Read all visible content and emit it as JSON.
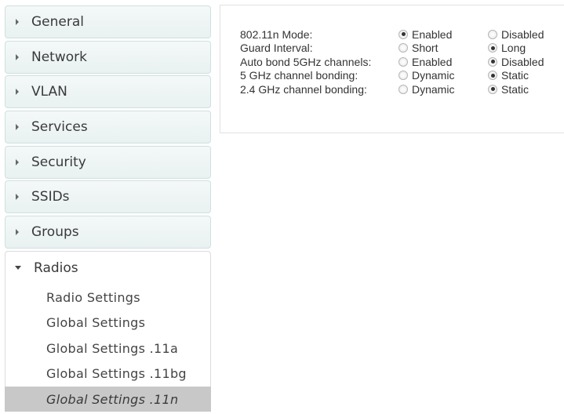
{
  "sidebar": {
    "items": [
      {
        "label": "General"
      },
      {
        "label": "Network"
      },
      {
        "label": "VLAN"
      },
      {
        "label": "Services"
      },
      {
        "label": "Security"
      },
      {
        "label": "SSIDs"
      },
      {
        "label": "Groups"
      }
    ],
    "radios": {
      "label": "Radios",
      "sub_items": [
        {
          "label": "Radio Settings"
        },
        {
          "label": "Global Settings"
        },
        {
          "label": "Global Settings .11a"
        },
        {
          "label": "Global Settings .11bg"
        },
        {
          "label": "Global Settings .11n",
          "active": true
        }
      ]
    }
  },
  "settings": {
    "rows": [
      {
        "label": "802.11n Mode:",
        "option1": "Enabled",
        "option2": "Disabled",
        "selected": "option1"
      },
      {
        "label": "Guard Interval:",
        "option1": "Short",
        "option2": "Long",
        "selected": "option2"
      },
      {
        "label": "Auto bond 5GHz channels:",
        "option1": "Enabled",
        "option2": "Disabled",
        "selected": "option2"
      },
      {
        "label": "5 GHz channel bonding:",
        "option1": "Dynamic",
        "option2": "Static",
        "selected": "option2"
      },
      {
        "label": "2.4 GHz channel bonding:",
        "option1": "Dynamic",
        "option2": "Static",
        "selected": "option2"
      }
    ]
  },
  "colors": {
    "active_item_bg": "#c8c8c8",
    "nav_border": "#cfe0e0"
  },
  "icons": {
    "collapsed": "caret-right-icon",
    "expanded": "caret-down-icon"
  }
}
